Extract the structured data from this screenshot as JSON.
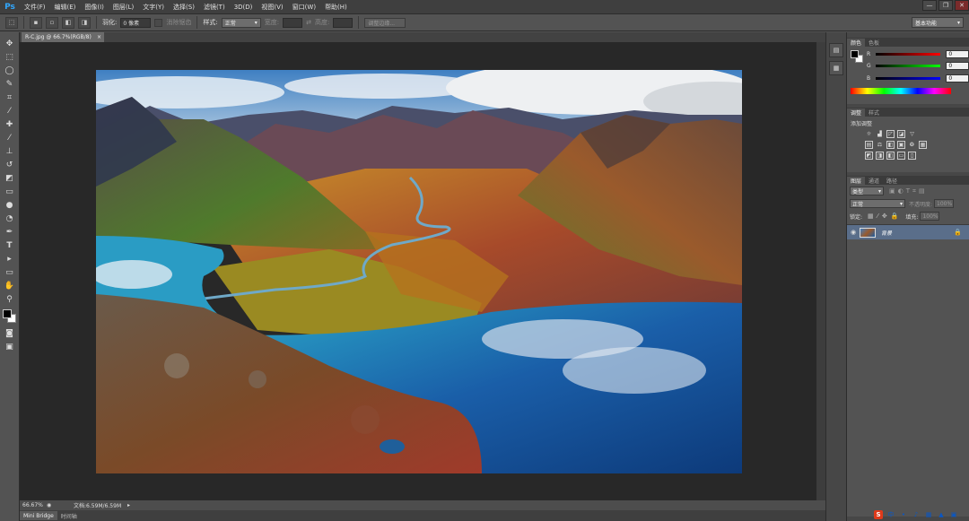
{
  "app": {
    "logo": "Ps"
  },
  "menu": [
    "文件(F)",
    "编辑(E)",
    "图像(I)",
    "图层(L)",
    "文字(Y)",
    "选择(S)",
    "滤镜(T)",
    "3D(D)",
    "视图(V)",
    "窗口(W)",
    "帮助(H)"
  ],
  "window_controls": {
    "minimize": "—",
    "restore": "❐",
    "close": "✕"
  },
  "options": {
    "feather_label": "羽化:",
    "feather_value": "0 像素",
    "antialias": "消除锯齿",
    "style_label": "样式:",
    "style_value": "正常",
    "width_label": "宽度:",
    "height_label": "高度:",
    "refine_edge": "调整边缘...",
    "workspace": "基本功能"
  },
  "document": {
    "tab_title": "R-C.jpg @ 66.7%(RGB/8)",
    "tab_close": "×"
  },
  "status": {
    "zoom": "66.67%",
    "doc_info": "文档:6.59M/6.59M"
  },
  "bottom_tabs": [
    "Mini Bridge",
    "时间轴"
  ],
  "color_panel": {
    "tabs": [
      "颜色",
      "色板"
    ],
    "channels": [
      {
        "name": "R",
        "value": "0"
      },
      {
        "name": "G",
        "value": "0"
      },
      {
        "name": "B",
        "value": "0"
      }
    ]
  },
  "adjust_panel": {
    "tabs": [
      "调整",
      "样式"
    ],
    "title": "添加调整"
  },
  "layers_panel": {
    "tabs": [
      "图层",
      "通道",
      "路径"
    ],
    "filter_kind": "类型",
    "blend_mode": "正常",
    "opacity_label": "不透明度:",
    "opacity_value": "100%",
    "lock_label": "锁定:",
    "fill_label": "填充:",
    "fill_value": "100%",
    "layers": [
      {
        "name": "背景",
        "visible": true,
        "locked": true
      }
    ]
  },
  "colors": {
    "accent": "#31a8ff",
    "canvas_bg": "#282828",
    "ui_bg": "#535353"
  }
}
